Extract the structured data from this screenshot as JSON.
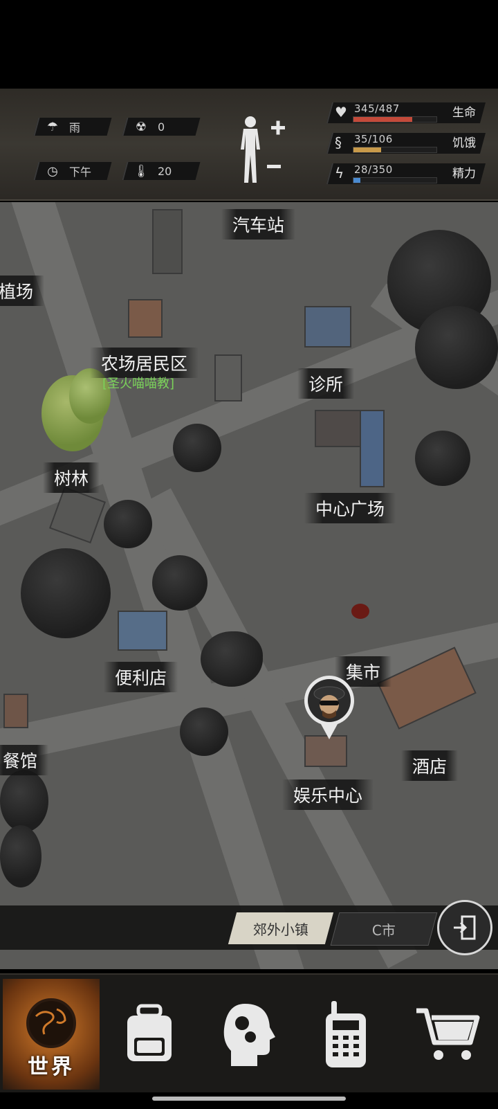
{
  "hud": {
    "weather": {
      "icon": "cloud-rain-icon",
      "label": "雨"
    },
    "radiation": {
      "icon": "radiation-icon",
      "value": "0"
    },
    "time": {
      "icon": "clock-icon",
      "label": "下午"
    },
    "temperature": {
      "icon": "thermometer-icon",
      "value": "20"
    },
    "body_icon": "human-figure-icon",
    "stats": [
      {
        "name": "生命",
        "value": "345/487",
        "fraction": 0.708,
        "color": "#c44a3a",
        "icon": "heart-pulse-icon"
      },
      {
        "name": "饥饿",
        "value": "35/106",
        "fraction": 0.33,
        "color": "#c89a4a",
        "icon": "stomach-icon"
      },
      {
        "name": "精力",
        "value": "28/350",
        "fraction": 0.08,
        "color": "#4a8ad0",
        "icon": "energy-icon"
      }
    ]
  },
  "map": {
    "locations": {
      "bus_station": "汽车站",
      "farm_left": "植场",
      "farm_residence": "农场居民区",
      "faction": "[圣火喵喵教]",
      "clinic": "诊所",
      "forest": "树林",
      "central_square": "中心广场",
      "market": "集市",
      "convenience_store": "便利店",
      "restaurant": "餐馆",
      "hotel": "酒店",
      "entertainment_center": "娱乐中心"
    },
    "player_icon": "player-avatar-icon"
  },
  "regions": {
    "active": "郊外小镇",
    "other": "C市",
    "exit_icon": "exit-door-icon"
  },
  "nav": {
    "world_label": "世界",
    "items": [
      "globe-icon",
      "backpack-icon",
      "head-gears-icon",
      "radio-icon",
      "cart-icon"
    ]
  }
}
